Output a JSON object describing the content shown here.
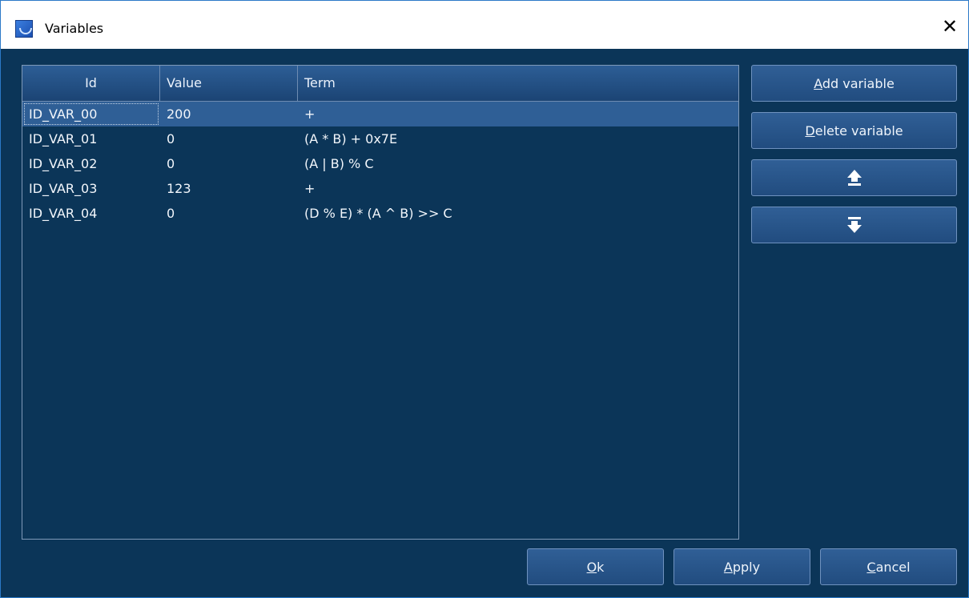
{
  "window": {
    "title": "Variables",
    "close_glyph": "✕"
  },
  "table": {
    "columns": [
      "Id",
      "Value",
      "Term"
    ],
    "rows": [
      {
        "id": "ID_VAR_00",
        "value": "200",
        "term": "+"
      },
      {
        "id": "ID_VAR_01",
        "value": "0",
        "term": "(A * B) + 0x7E"
      },
      {
        "id": "ID_VAR_02",
        "value": "0",
        "term": "(A | B) % C"
      },
      {
        "id": "ID_VAR_03",
        "value": "123",
        "term": "+"
      },
      {
        "id": "ID_VAR_04",
        "value": "0",
        "term": "(D % E) * (A ^ B) >> C"
      }
    ],
    "selected_row": 0
  },
  "side_buttons": {
    "add_prefix": "A",
    "add_rest": "dd variable",
    "delete_prefix": "D",
    "delete_rest": "elete variable",
    "move_up_icon": "move-to-top-icon",
    "move_down_icon": "move-to-bottom-icon"
  },
  "bottom_buttons": {
    "ok_prefix": "O",
    "ok_rest": "k",
    "apply_prefix": "A",
    "apply_rest": "pply",
    "cancel_prefix": "C",
    "cancel_rest": "ancel"
  },
  "colors": {
    "background": "#0b3558",
    "header": "#2d5e96",
    "selection": "#2f5f96",
    "button": "#305f96"
  }
}
